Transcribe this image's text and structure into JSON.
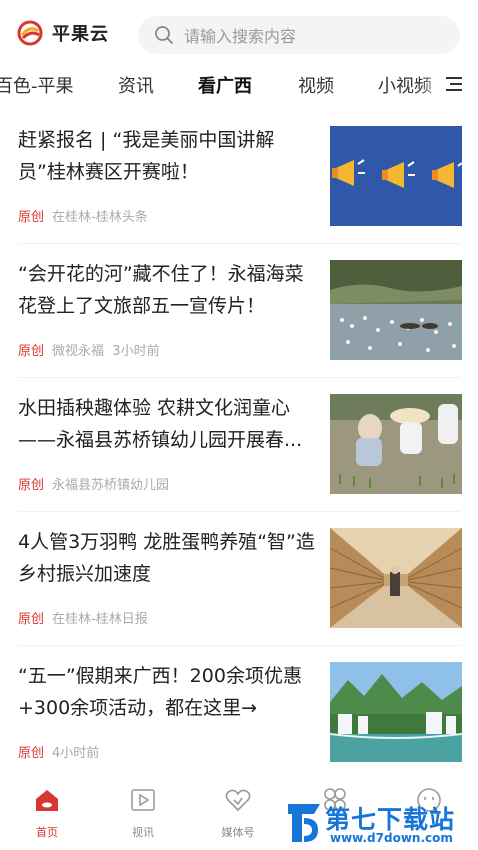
{
  "app": {
    "title": "平果云",
    "brand_color": "#d8372f"
  },
  "search": {
    "placeholder": "请输入搜索内容",
    "icon": "search-icon"
  },
  "tabs": [
    {
      "label": "百色-平果",
      "active": false
    },
    {
      "label": "资讯",
      "active": false
    },
    {
      "label": "看广西",
      "active": true
    },
    {
      "label": "视频",
      "active": false
    },
    {
      "label": "小视频",
      "active": false
    }
  ],
  "tab_menu_icon": "menu-icon",
  "news": [
    {
      "title": "赶紧报名 | “我是美丽中国讲解员”桂林赛区开赛啦！",
      "tag": "原创",
      "source": "在桂林-桂林头条",
      "time": "",
      "thumb": "megaphone-banner"
    },
    {
      "title": "“会开花的河”藏不住了！永福海菜花登上了文旅部五一宣传片！",
      "tag": "原创",
      "source": "微视永福",
      "time": "3小时前",
      "thumb": "river-flowers-photo"
    },
    {
      "title": "水田插秧趣体验 农耕文化润童心——永福县苏桥镇幼儿园开展春...",
      "tag": "原创",
      "source": "永福县苏桥镇幼儿园",
      "time": "",
      "thumb": "children-planting-photo"
    },
    {
      "title": "4人管3万羽鸭 龙胜蛋鸭养殖“智”造乡村振兴加速度",
      "tag": "原创",
      "source": "在桂林-桂林日报",
      "time": "",
      "thumb": "duck-farm-photo"
    },
    {
      "title": "“五一”假期来广西！200余项优惠+300余项活动，都在这里→",
      "tag": "原创",
      "source": "",
      "time": "4小时前",
      "thumb": "waterfall-photo"
    }
  ],
  "bottom_nav": [
    {
      "label": "首页",
      "icon": "home-icon",
      "active": true
    },
    {
      "label": "视讯",
      "icon": "play-icon",
      "active": false
    },
    {
      "label": "媒体号",
      "icon": "heart-icon",
      "active": false
    },
    {
      "label": "",
      "icon": "apps-icon",
      "active": false
    },
    {
      "label": "",
      "icon": "user-icon",
      "active": false
    }
  ],
  "watermark": {
    "text": "第七下载站",
    "url": "www.d7down.com",
    "color": "#1576d8"
  }
}
